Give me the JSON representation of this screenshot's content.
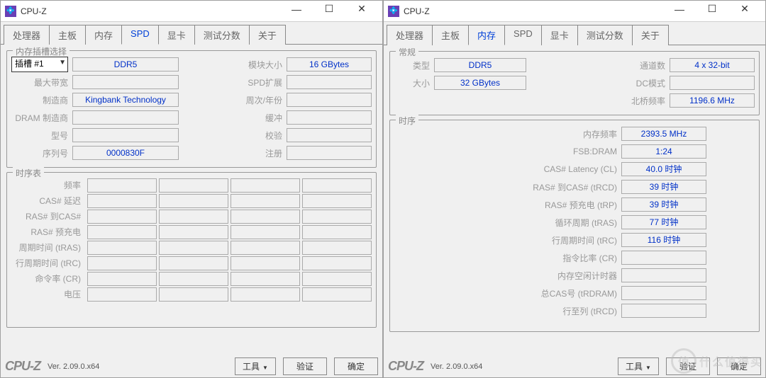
{
  "app": {
    "title": "CPU-Z",
    "logo": "CPU-Z",
    "version": "Ver. 2.09.0.x64"
  },
  "winctrl": {
    "min": "—",
    "max": "☐",
    "close": "✕"
  },
  "tabs": [
    "处理器",
    "主板",
    "内存",
    "SPD",
    "显卡",
    "测试分数",
    "关于"
  ],
  "left": {
    "active_tab": 3,
    "group_slot": "内存插槽选择",
    "slot_value": "插槽 #1",
    "slot_type": "DDR5",
    "module_size_lbl": "模块大小",
    "module_size": "16 GBytes",
    "rows1": [
      {
        "l": "最大带宽",
        "v": "",
        "l2": "SPD扩展",
        "v2": ""
      },
      {
        "l": "制造商",
        "v": "Kingbank Technology",
        "l2": "周次/年份",
        "v2": ""
      },
      {
        "l": "DRAM 制造商",
        "v": "",
        "l2": "缓冲",
        "v2": ""
      },
      {
        "l": "型号",
        "v": "",
        "l2": "校验",
        "v2": ""
      },
      {
        "l": "序列号",
        "v": "0000830F",
        "l2": "注册",
        "v2": ""
      }
    ],
    "group_tim": "时序表",
    "tim_labels": [
      "频率",
      "CAS# 延迟",
      "RAS# 到CAS#",
      "RAS# 预充电",
      "周期时间 (tRAS)",
      "行周期时间 (tRC)",
      "命令率 (CR)",
      "电压"
    ]
  },
  "right": {
    "active_tab": 2,
    "group_gen": "常规",
    "gen": {
      "type_lbl": "类型",
      "type": "DDR5",
      "size_lbl": "大小",
      "size": "32 GBytes",
      "chan_lbl": "通道数",
      "chan": "4 x 32-bit",
      "dcmode_lbl": "DC模式",
      "dcmode": "",
      "nb_lbl": "北桥频率",
      "nb": "1196.6 MHz"
    },
    "group_tim": "时序",
    "tim": [
      {
        "l": "内存频率",
        "v": "2393.5 MHz"
      },
      {
        "l": "FSB:DRAM",
        "v": "1:24"
      },
      {
        "l": "CAS# Latency (CL)",
        "v": "40.0 时钟"
      },
      {
        "l": "RAS# 到CAS#  (tRCD)",
        "v": "39 时钟"
      },
      {
        "l": "RAS# 预充电  (tRP)",
        "v": "39 时钟"
      },
      {
        "l": "循环周期  (tRAS)",
        "v": "77 时钟"
      },
      {
        "l": "行周期时间  (tRC)",
        "v": "116 时钟"
      },
      {
        "l": "指令比率  (CR)",
        "v": ""
      },
      {
        "l": "内存空闲计时器",
        "v": ""
      },
      {
        "l": "总CAS号  (tRDRAM)",
        "v": ""
      },
      {
        "l": "行至列  (tRCD)",
        "v": ""
      }
    ]
  },
  "buttons": {
    "tools": "工具",
    "verify": "验证",
    "ok": "确定"
  },
  "watermark": {
    "icon": "值",
    "text": "什么值得买"
  }
}
